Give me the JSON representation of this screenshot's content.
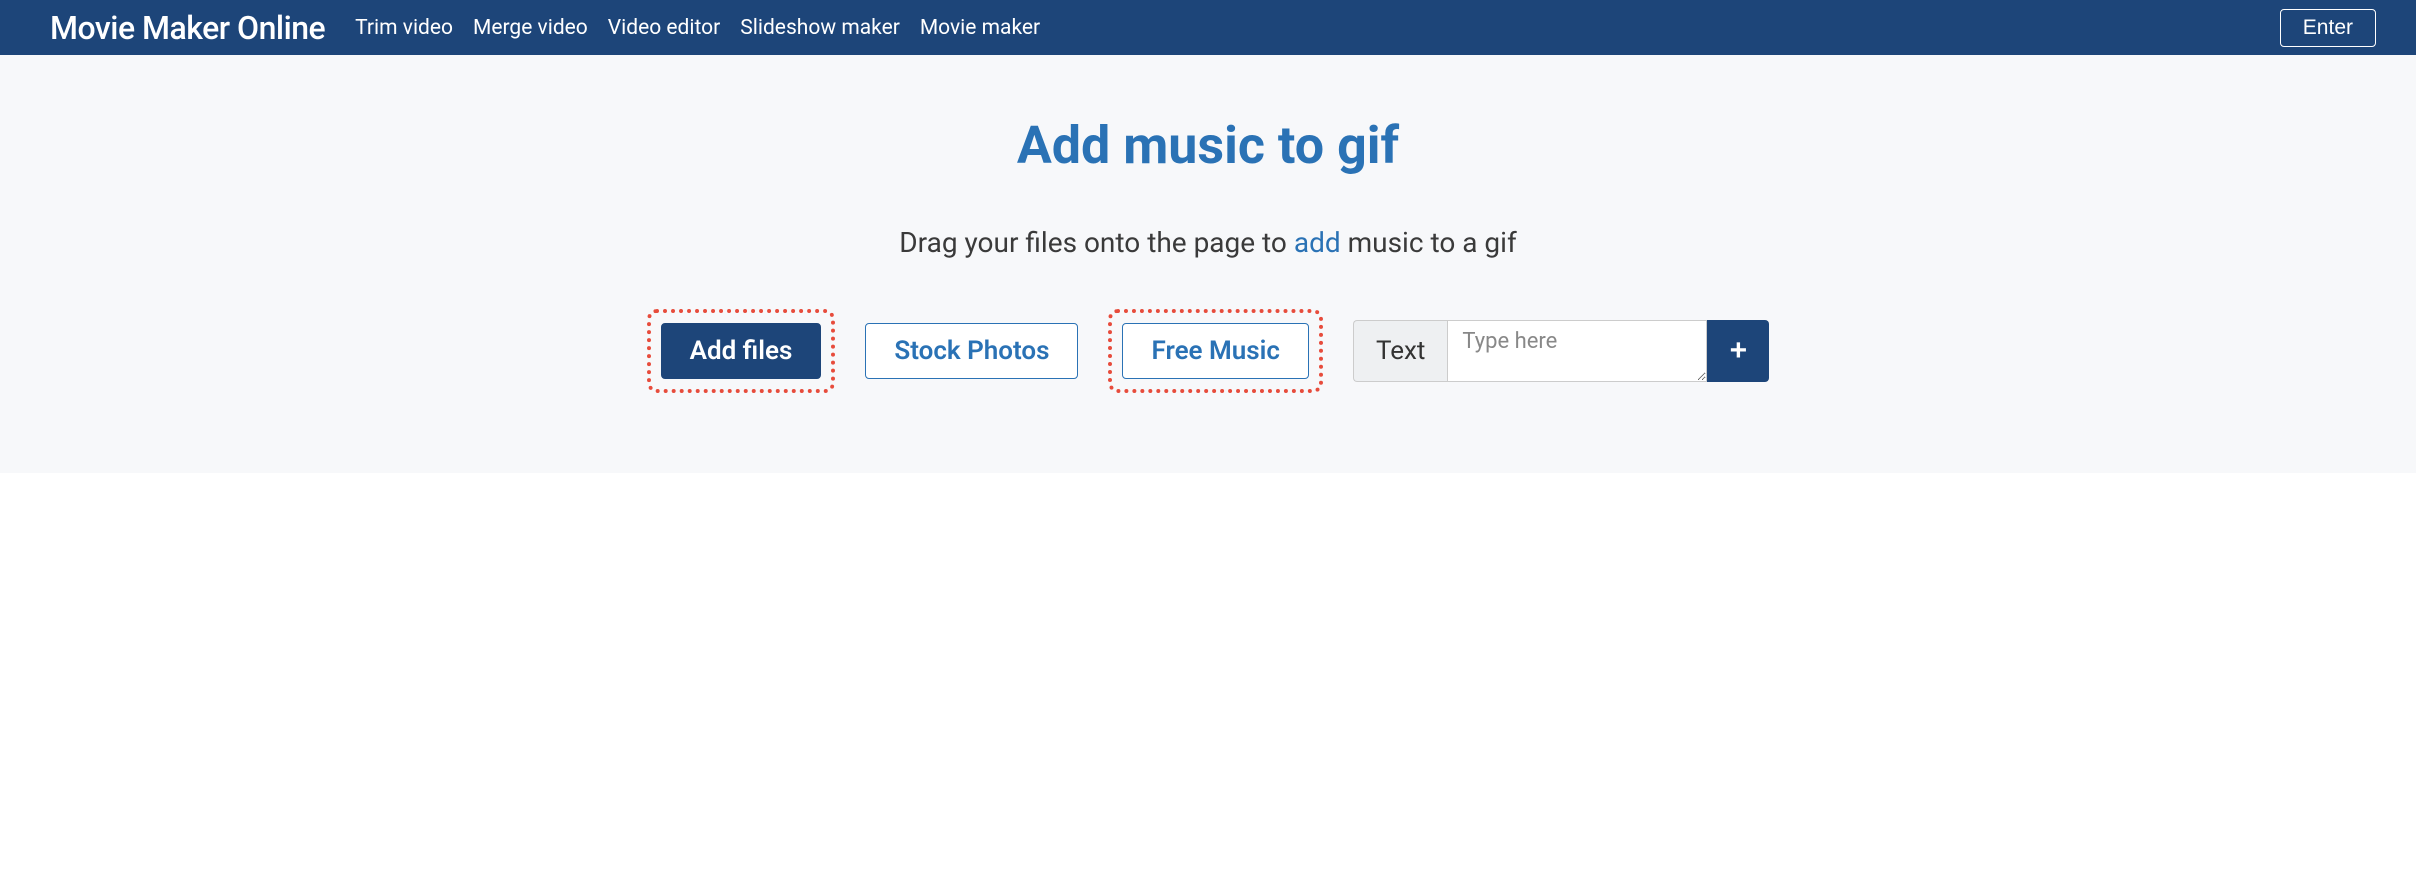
{
  "navbar": {
    "brand": "Movie Maker Online",
    "links": [
      "Trim video",
      "Merge video",
      "Video editor",
      "Slideshow maker",
      "Movie maker"
    ],
    "enter": "Enter"
  },
  "hero": {
    "title": "Add music to gif",
    "subtitle_pre": "Drag your files onto the page to ",
    "subtitle_link": "add",
    "subtitle_post": " music to a gif"
  },
  "controls": {
    "add_files": "Add files",
    "stock_photos": "Stock Photos",
    "free_music": "Free Music",
    "text_label": "Text",
    "text_placeholder": "Type here",
    "plus": "+"
  }
}
